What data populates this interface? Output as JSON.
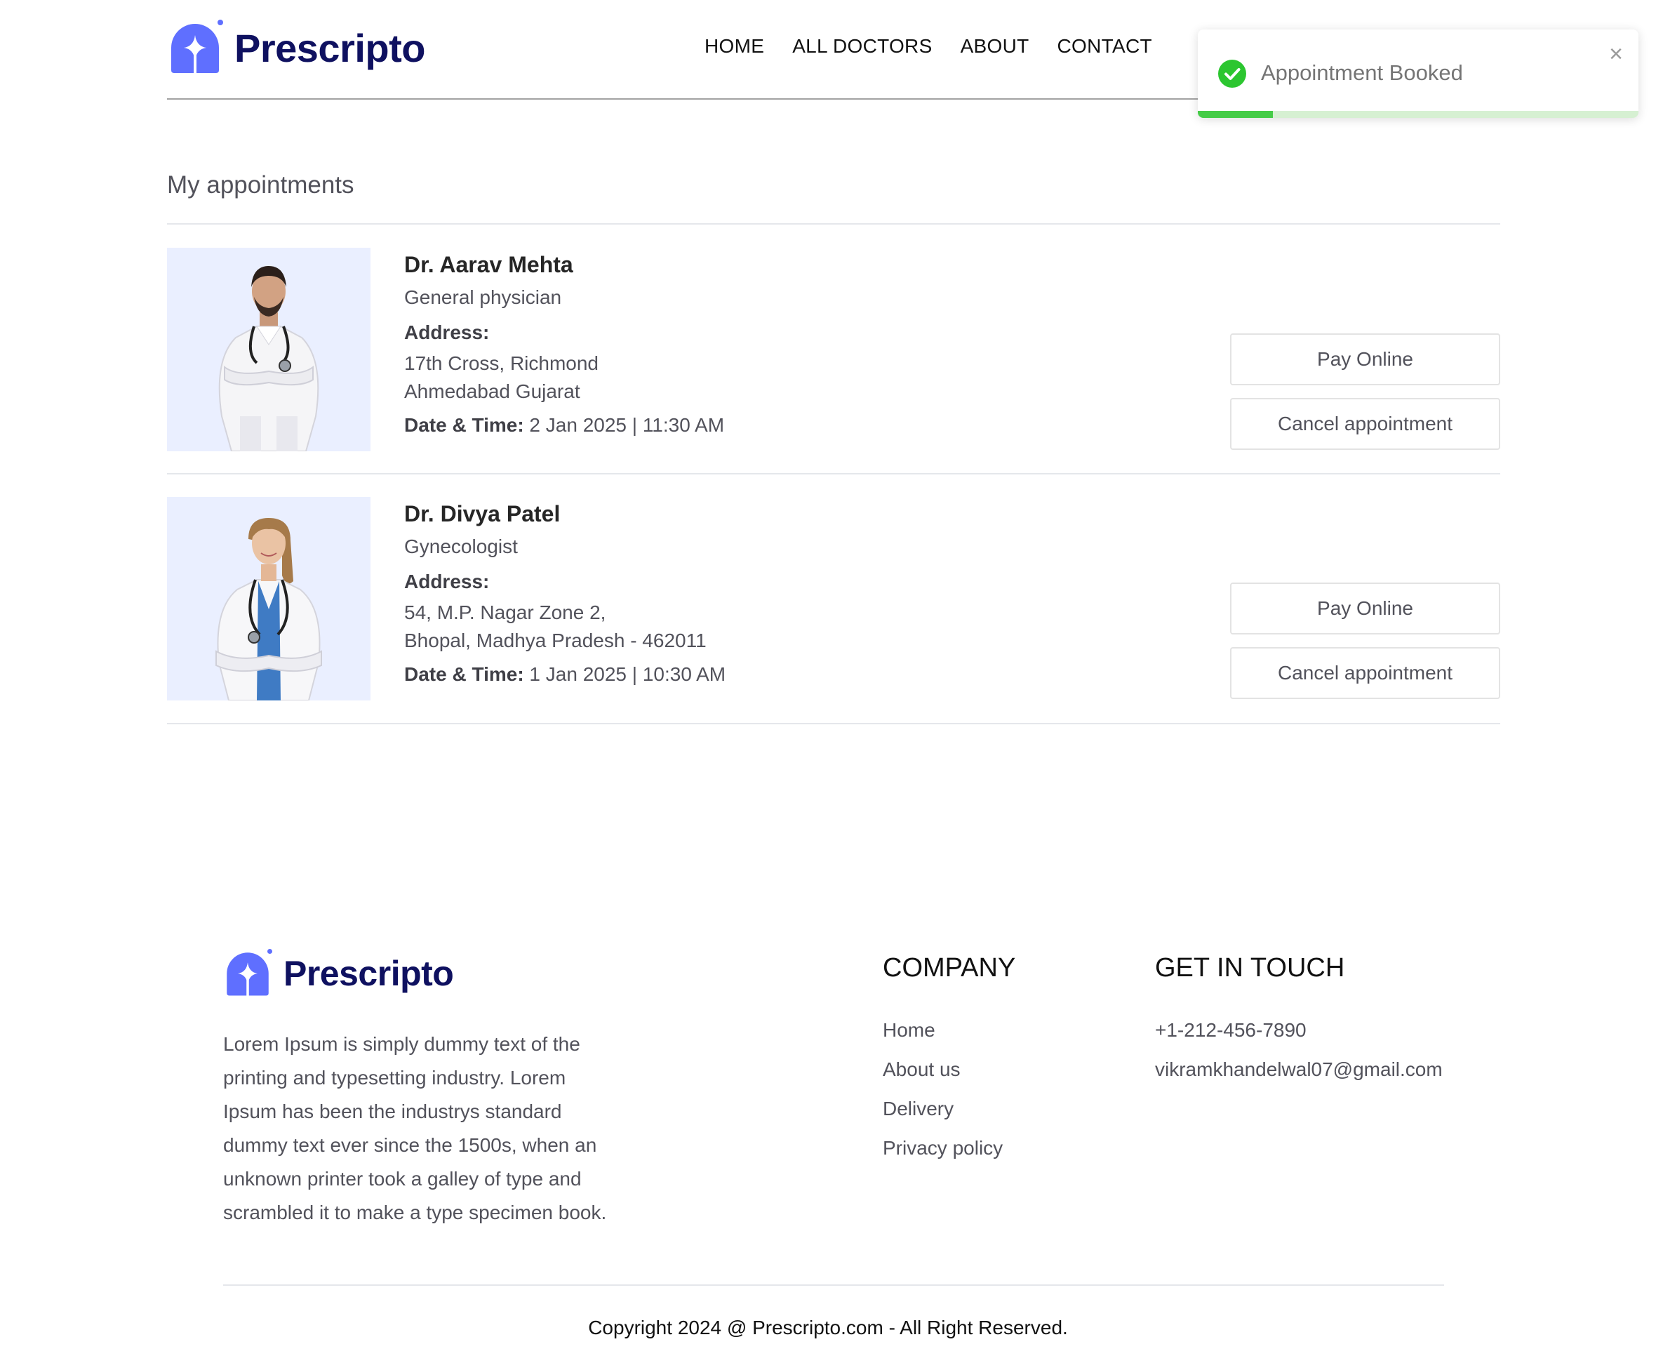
{
  "brand": {
    "name": "Prescripto",
    "color": "#5f6fff"
  },
  "nav": {
    "items": [
      "HOME",
      "ALL DOCTORS",
      "ABOUT",
      "CONTACT"
    ]
  },
  "toast": {
    "message": "Appointment Booked",
    "close": "×",
    "progress": 0.17,
    "color": "#07bc0c"
  },
  "page": {
    "title": "My appointments"
  },
  "appointments": [
    {
      "name": "Dr. Aarav Mehta",
      "speciality": "General physician",
      "address_label": "Address:",
      "address_line1": "17th Cross, Richmond",
      "address_line2": "Ahmedabad Gujarat",
      "datetime_label": "Date & Time:",
      "datetime": " 2 Jan 2025 | 11:30 AM",
      "pay_label": "Pay Online",
      "cancel_label": "Cancel appointment"
    },
    {
      "name": "Dr. Divya Patel",
      "speciality": "Gynecologist",
      "address_label": "Address:",
      "address_line1": "54, M.P. Nagar Zone 2,",
      "address_line2": "Bhopal, Madhya Pradesh - 462011",
      "datetime_label": "Date & Time:",
      "datetime": " 1 Jan 2025 | 10:30 AM",
      "pay_label": "Pay Online",
      "cancel_label": "Cancel appointment"
    }
  ],
  "footer": {
    "description": "Lorem Ipsum is simply dummy text of the printing and typesetting industry. Lorem Ipsum has been the industrys standard dummy text ever since the 1500s, when an unknown printer took a galley of type and scrambled it to make a type specimen book.",
    "company_heading": "COMPANY",
    "company_links": [
      "Home",
      "About us",
      "Delivery",
      "Privacy policy"
    ],
    "contact_heading": "GET IN TOUCH",
    "phone": "+1-212-456-7890",
    "email": "vikramkhandelwal07@gmail.com",
    "copyright": "Copyright 2024 @ Prescripto.com - All Right Reserved."
  }
}
